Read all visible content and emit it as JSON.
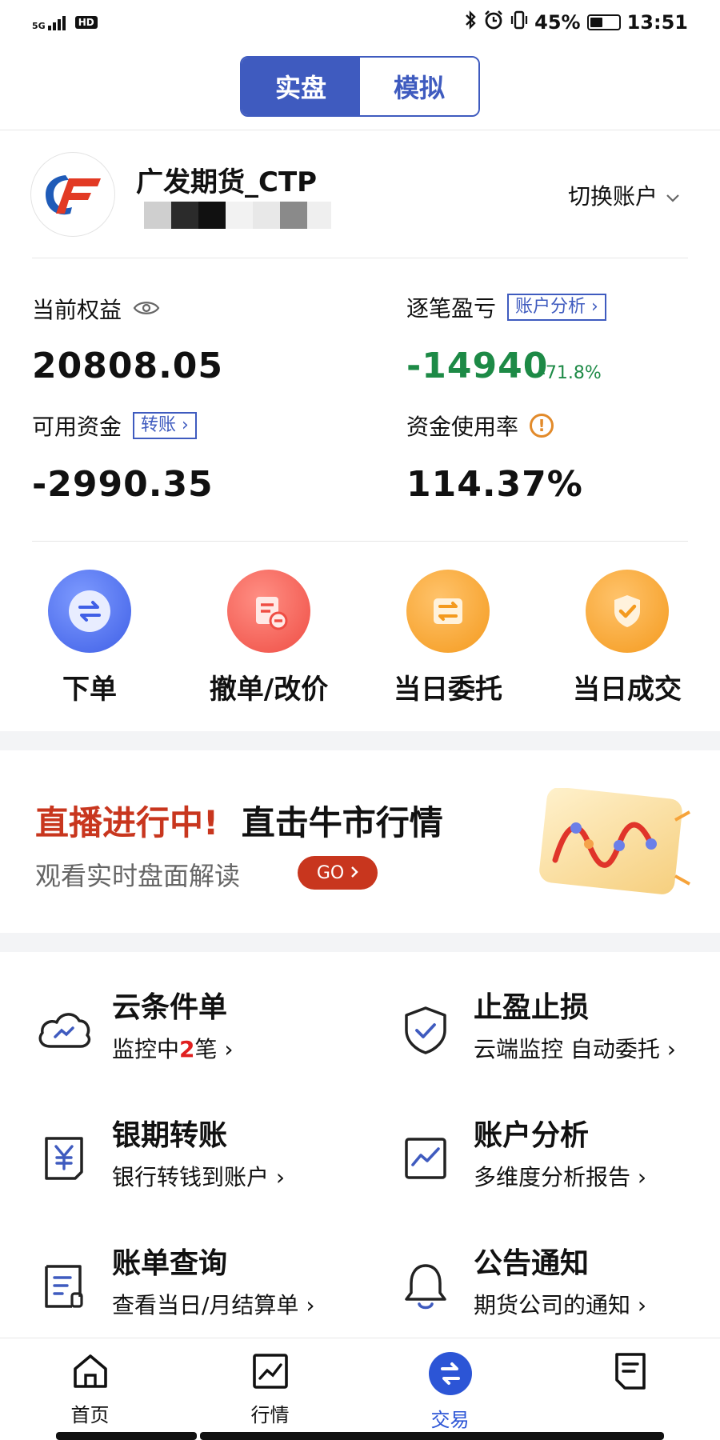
{
  "status_bar": {
    "network": "5G",
    "hd": "HD",
    "battery": "45%",
    "battery_level": 0.45,
    "time": "13:51"
  },
  "mode_toggle": {
    "live": "实盘",
    "sim": "模拟"
  },
  "account": {
    "name": "广发期货_CTP",
    "switch_label": "切换账户"
  },
  "stats": {
    "equity_label": "当前权益",
    "equity_value": "20808.05",
    "pnl_label": "逐笔盈亏",
    "pnl_tag": "账户分析",
    "pnl_value": "-14940",
    "pnl_pct": "-71.8%",
    "available_label": "可用资金",
    "available_tag": "转账",
    "available_value": "-2990.35",
    "usage_label": "资金使用率",
    "usage_value": "114.37%"
  },
  "quick_actions": [
    {
      "label": "下单"
    },
    {
      "label": "撤单/改价"
    },
    {
      "label": "当日委托"
    },
    {
      "label": "当日成交"
    }
  ],
  "banner": {
    "title_red": "直播进行中!",
    "title_rest": "直击牛市行情",
    "subtitle": "观看实时盘面解读",
    "go": "GO"
  },
  "functions": [
    {
      "title": "云条件单",
      "sub_prefix": "监控中",
      "sub_num": "2",
      "sub_suffix": "笔"
    },
    {
      "title": "止盈止损",
      "sub": "云端监控 自动委托"
    },
    {
      "title": "银期转账",
      "sub": "银行转钱到账户"
    },
    {
      "title": "账户分析",
      "sub": "多维度分析报告"
    },
    {
      "title": "账单查询",
      "sub": "查看当日/月结算单"
    },
    {
      "title": "公告通知",
      "sub": "期货公司的通知"
    }
  ],
  "bottom_nav": [
    {
      "label": "首页"
    },
    {
      "label": "行情"
    },
    {
      "label": "交易"
    },
    {
      "label": ""
    }
  ],
  "colors": {
    "accent": "#3f5bbf",
    "profit_loss": "#1d8a46",
    "banner_red": "#c8361e",
    "nav_active": "#2c55d6"
  }
}
